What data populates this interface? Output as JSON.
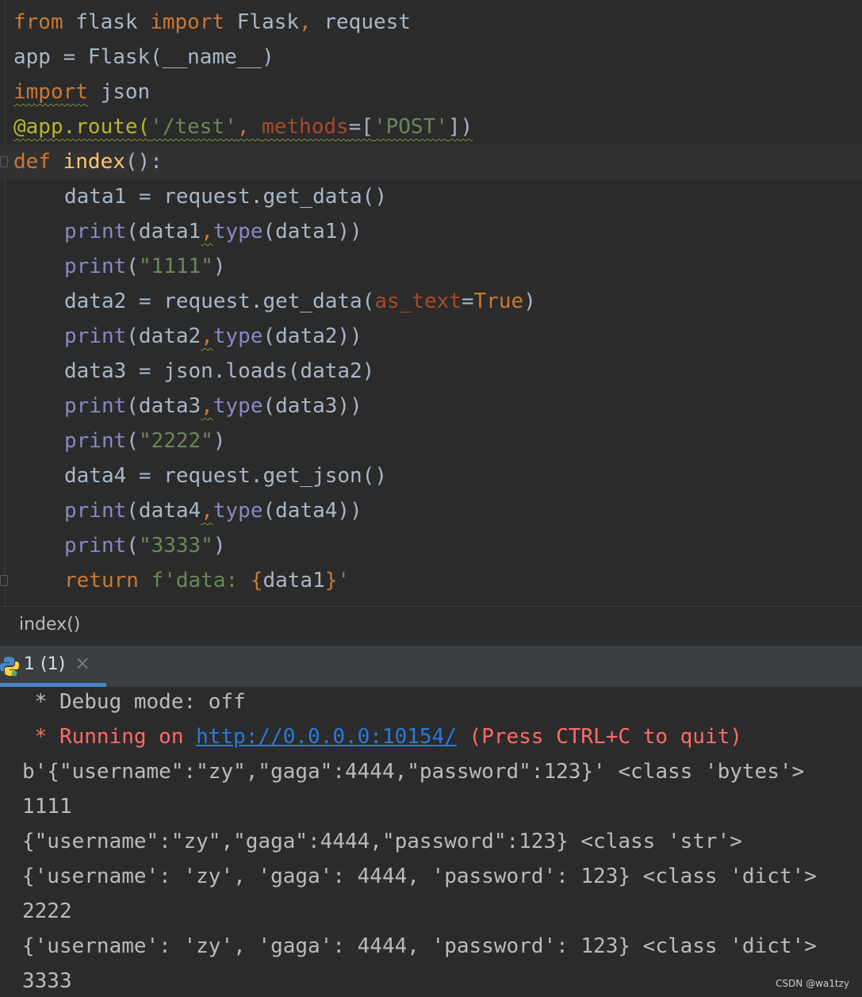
{
  "editor": {
    "lines": [
      {
        "tokens": [
          [
            "kw",
            "from"
          ],
          [
            "t",
            " flask "
          ],
          [
            "kw",
            "import"
          ],
          [
            "t",
            " Flask"
          ],
          [
            "kw",
            ","
          ],
          [
            "t",
            " request"
          ]
        ]
      },
      {
        "tokens": [
          [
            "t",
            "app = Flask(__name__)"
          ]
        ]
      },
      {
        "tokens": [
          [
            "kww",
            "import"
          ],
          [
            "t",
            " json"
          ]
        ]
      },
      {
        "tokens": [
          [
            "decw",
            "@app.route("
          ],
          [
            "strw",
            "'/test'"
          ],
          [
            "kww",
            ", "
          ],
          [
            "parw",
            "methods"
          ],
          [
            "tw",
            "=["
          ],
          [
            "strw",
            "'POST'"
          ],
          [
            "tw",
            "])"
          ]
        ]
      },
      {
        "tokens": [
          [
            "kw",
            "def"
          ],
          [
            "t",
            " "
          ],
          [
            "fn",
            "index"
          ],
          [
            "t",
            "():"
          ]
        ],
        "current": true
      },
      {
        "tokens": [
          [
            "ind",
            ""
          ],
          [
            "t",
            "data1 = request.get_data()"
          ]
        ]
      },
      {
        "tokens": [
          [
            "ind",
            ""
          ],
          [
            "bi",
            "print"
          ],
          [
            "t",
            "(data1"
          ],
          [
            "kww",
            ","
          ],
          [
            "bi",
            "type"
          ],
          [
            "t",
            "(data1))"
          ]
        ]
      },
      {
        "tokens": [
          [
            "ind",
            ""
          ],
          [
            "bi",
            "print"
          ],
          [
            "t",
            "("
          ],
          [
            "str",
            "\"1111\""
          ],
          [
            "t",
            ")"
          ]
        ]
      },
      {
        "tokens": [
          [
            "ind",
            ""
          ],
          [
            "t",
            "data2 = request.get_data("
          ],
          [
            "par",
            "as_text"
          ],
          [
            "t",
            "="
          ],
          [
            "kw",
            "True"
          ],
          [
            "t",
            ")"
          ]
        ]
      },
      {
        "tokens": [
          [
            "ind",
            ""
          ],
          [
            "bi",
            "print"
          ],
          [
            "t",
            "(data2"
          ],
          [
            "kww",
            ","
          ],
          [
            "bi",
            "type"
          ],
          [
            "t",
            "(data2))"
          ]
        ]
      },
      {
        "tokens": [
          [
            "ind",
            ""
          ],
          [
            "t",
            "data3 = json.loads(data2)"
          ]
        ]
      },
      {
        "tokens": [
          [
            "ind",
            ""
          ],
          [
            "bi",
            "print"
          ],
          [
            "t",
            "(data3"
          ],
          [
            "kww",
            ","
          ],
          [
            "bi",
            "type"
          ],
          [
            "t",
            "(data3))"
          ]
        ]
      },
      {
        "tokens": [
          [
            "ind",
            ""
          ],
          [
            "bi",
            "print"
          ],
          [
            "t",
            "("
          ],
          [
            "str",
            "\"2222\""
          ],
          [
            "t",
            ")"
          ]
        ]
      },
      {
        "tokens": [
          [
            "ind",
            ""
          ],
          [
            "t",
            "data4 = request.get_json()"
          ]
        ]
      },
      {
        "tokens": [
          [
            "ind",
            ""
          ],
          [
            "bi",
            "print"
          ],
          [
            "t",
            "(data4"
          ],
          [
            "kww",
            ","
          ],
          [
            "bi",
            "type"
          ],
          [
            "t",
            "(data4))"
          ]
        ]
      },
      {
        "tokens": [
          [
            "ind",
            ""
          ],
          [
            "bi",
            "print"
          ],
          [
            "t",
            "("
          ],
          [
            "str",
            "\"3333\""
          ],
          [
            "t",
            ")"
          ]
        ]
      },
      {
        "tokens": [
          [
            "ind",
            ""
          ],
          [
            "kw",
            "return"
          ],
          [
            "t",
            " "
          ],
          [
            "str",
            "f'data: "
          ],
          [
            "kw",
            "{"
          ],
          [
            "t",
            "data1"
          ],
          [
            "kw",
            "}"
          ],
          [
            "str",
            "'"
          ]
        ]
      }
    ]
  },
  "breadcrumb": {
    "label": "index()"
  },
  "run_tab": {
    "label": "1 (1)",
    "close": "×",
    "icon": "python-icon"
  },
  "console": {
    "lines": [
      {
        "tokens": [
          [
            "t",
            " * Debug mode: off"
          ]
        ]
      },
      {
        "tokens": [
          [
            "err",
            " * Running on "
          ],
          [
            "link",
            "http://0.0.0.0:10154/"
          ],
          [
            "err",
            " (Press CTRL+C to quit)"
          ]
        ]
      },
      {
        "tokens": [
          [
            "t",
            "b'{\"username\":\"zy\",\"gaga\":4444,\"password\":123}' <class 'bytes'>"
          ]
        ]
      },
      {
        "tokens": [
          [
            "t",
            "1111"
          ]
        ]
      },
      {
        "tokens": [
          [
            "t",
            "{\"username\":\"zy\",\"gaga\":4444,\"password\":123} <class 'str'>"
          ]
        ]
      },
      {
        "tokens": [
          [
            "t",
            "{'username': 'zy', 'gaga': 4444, 'password': 123} <class 'dict'>"
          ]
        ]
      },
      {
        "tokens": [
          [
            "t",
            "2222"
          ]
        ]
      },
      {
        "tokens": [
          [
            "t",
            "{'username': 'zy', 'gaga': 4444, 'password': 123} <class 'dict'>"
          ]
        ]
      },
      {
        "tokens": [
          [
            "t",
            "3333"
          ]
        ]
      }
    ]
  },
  "watermark": "CSDN @wa1tzy",
  "colors": {
    "background": "#2b2b2b",
    "keyword": "#cc7832",
    "function": "#ffc66d",
    "builtin": "#8888c6",
    "string": "#6a8759",
    "decorator": "#bbb529",
    "error_text": "#ff6b68",
    "link": "#287bde",
    "tab_accent": "#4a88c7"
  }
}
